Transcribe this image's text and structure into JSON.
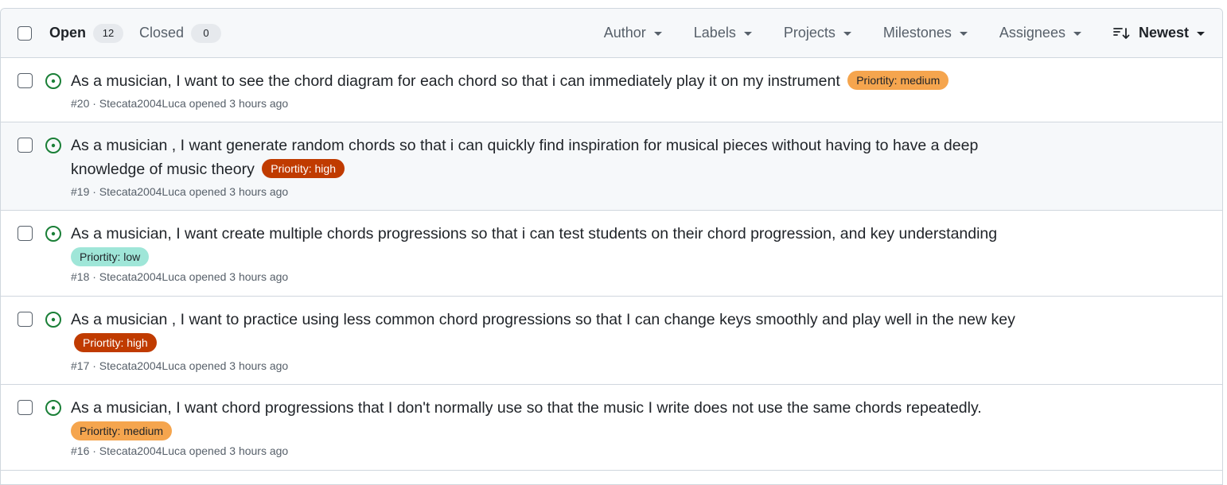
{
  "header": {
    "open_label": "Open",
    "open_count": "12",
    "closed_label": "Closed",
    "closed_count": "0",
    "filters": [
      "Author",
      "Labels",
      "Projects",
      "Milestones",
      "Assignees"
    ],
    "sort_label": "Newest"
  },
  "colors": {
    "priority_medium_bg": "#f5a54e",
    "priority_medium_fg": "#1f2328",
    "priority_high_bg": "#c03b00",
    "priority_high_fg": "#ffffff",
    "priority_low_bg": "#9fe6d8",
    "priority_low_fg": "#1f2328",
    "open_icon": "#1a7f37"
  },
  "issues": [
    {
      "title": "As a musician, I want to see the chord diagram for each chord so that i can immediately play it on my instrument",
      "label": "Priortity: medium",
      "meta": "#20 · Stecata2004Luca opened 3 hours ago"
    },
    {
      "title": "As a musician , I want generate random chords so that i can quickly find inspiration for musical pieces without having to have a deep knowledge of music theory",
      "label": "Priortity: high",
      "meta": "#19 · Stecata2004Luca opened 3 hours ago"
    },
    {
      "title": "As a musician, I want create multiple chords progressions so that i can test students on their chord progression, and key understanding",
      "label": "Priortity: low",
      "meta": "#18 · Stecata2004Luca opened 3 hours ago"
    },
    {
      "title": "As a musician , I want to practice using less common chord progressions so that I can change keys smoothly and play well in the new key",
      "label": "Priortity: high",
      "meta": "#17 · Stecata2004Luca opened 3 hours ago"
    },
    {
      "title": "As a musician, I want chord progressions that I don't normally use so that the music I write does not use the same chords repeatedly.",
      "label": "Priortity: medium",
      "meta": "#16 · Stecata2004Luca opened 3 hours ago"
    }
  ]
}
